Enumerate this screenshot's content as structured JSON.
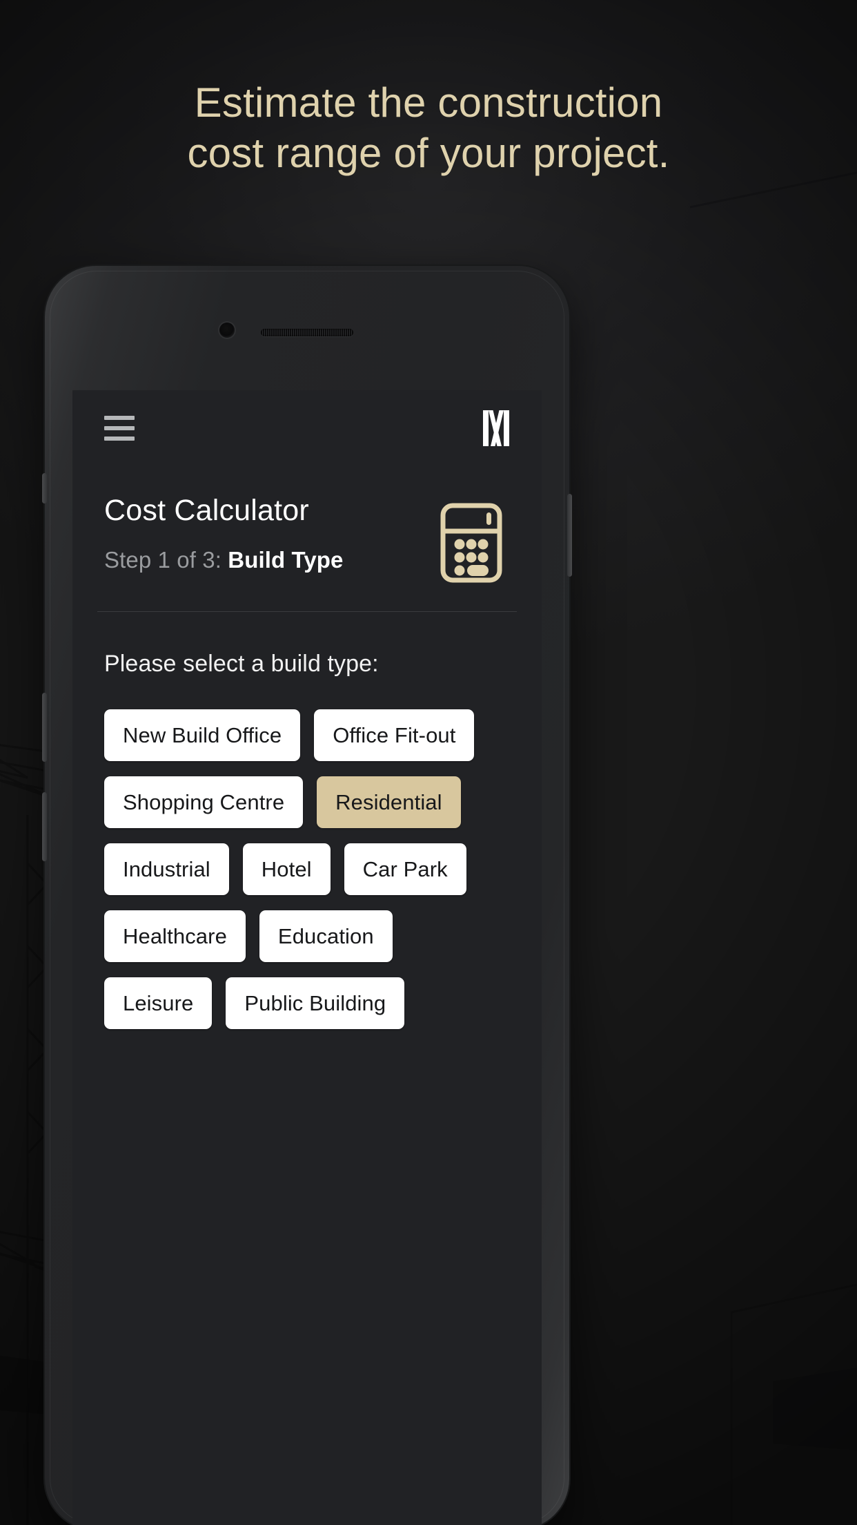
{
  "headline": {
    "line1": "Estimate the construction",
    "line2": "cost range of your project."
  },
  "colors": {
    "accent": "#dfd2ad",
    "selected_button": "#d8c79e",
    "button_bg": "#ffffff",
    "screen_bg": "#212225",
    "page_bg": "#191919",
    "muted_text": "#9a9c9f"
  },
  "app": {
    "menu_icon": "hamburger-icon",
    "logo_icon": "brand-m-logo",
    "title": "Cost Calculator",
    "step_prefix": "Step 1 of 3: ",
    "step_value": "Build Type",
    "header_icon": "calculator-icon",
    "prompt": "Please select a build type:",
    "build_types": [
      {
        "label": "New Build Office",
        "selected": false
      },
      {
        "label": "Office Fit-out",
        "selected": false
      },
      {
        "label": "Shopping Centre",
        "selected": false
      },
      {
        "label": "Residential",
        "selected": true
      },
      {
        "label": "Industrial",
        "selected": false
      },
      {
        "label": "Hotel",
        "selected": false
      },
      {
        "label": "Car Park",
        "selected": false
      },
      {
        "label": "Healthcare",
        "selected": false
      },
      {
        "label": "Education",
        "selected": false
      },
      {
        "label": "Leisure",
        "selected": false
      },
      {
        "label": "Public Building",
        "selected": false
      }
    ]
  },
  "device": {
    "camera_icon": "front-camera",
    "speaker_icon": "earpiece-speaker"
  }
}
